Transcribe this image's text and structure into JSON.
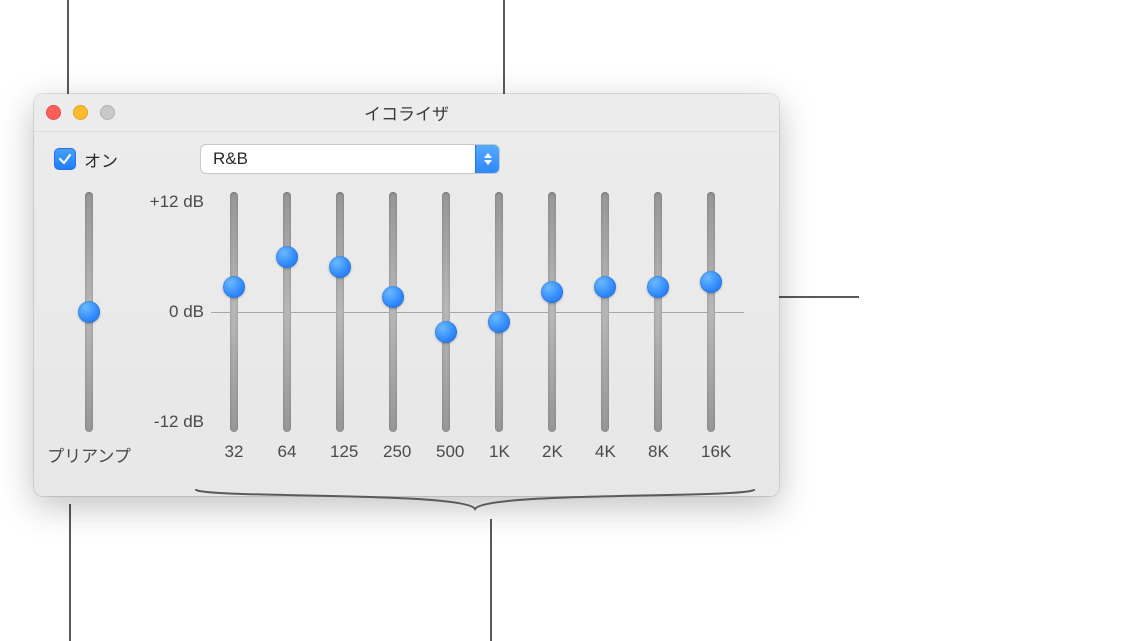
{
  "window": {
    "title": "イコライザ"
  },
  "checkbox": {
    "checked": true,
    "label": "オン"
  },
  "preset": {
    "selected": "R&B"
  },
  "db_labels": {
    "top": "+12 dB",
    "mid": "0 dB",
    "bot": "-12 dB"
  },
  "preamp": {
    "label": "プリアンプ",
    "value_db": 0
  },
  "bands": [
    {
      "label": "32",
      "value_db": 2.5
    },
    {
      "label": "64",
      "value_db": 5.5
    },
    {
      "label": "125",
      "value_db": 4.5
    },
    {
      "label": "250",
      "value_db": 1.5
    },
    {
      "label": "500",
      "value_db": -2.0
    },
    {
      "label": "1K",
      "value_db": -1.0
    },
    {
      "label": "2K",
      "value_db": 2.0
    },
    {
      "label": "4K",
      "value_db": 2.5
    },
    {
      "label": "8K",
      "value_db": 2.5
    },
    {
      "label": "16K",
      "value_db": 3.0
    }
  ],
  "chart_data": {
    "type": "bar",
    "title": "イコライザ",
    "categories": [
      "32",
      "64",
      "125",
      "250",
      "500",
      "1K",
      "2K",
      "4K",
      "8K",
      "16K"
    ],
    "values": [
      2.5,
      5.5,
      4.5,
      1.5,
      -2.0,
      -1.0,
      2.0,
      2.5,
      2.5,
      3.0
    ],
    "ylabel": "dB",
    "ylim": [
      -12,
      12
    ]
  }
}
